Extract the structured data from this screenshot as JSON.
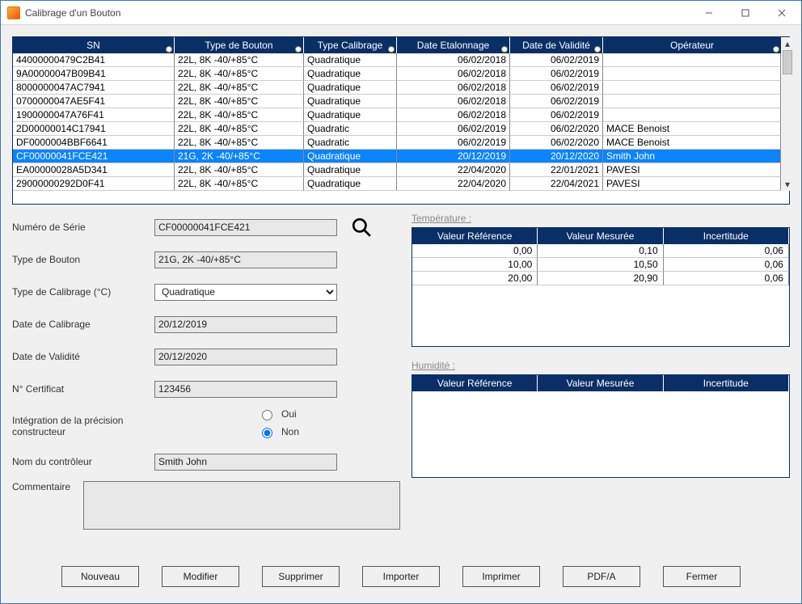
{
  "window": {
    "title": "Calibrage d'un Bouton"
  },
  "grid": {
    "columns": [
      "SN",
      "Type de Bouton",
      "Type Calibrage",
      "Date Etalonnage",
      "Date de Validité",
      "Opérateur"
    ],
    "rows": [
      {
        "sn": "44000000479C2B41",
        "type": "22L, 8K -40/+85°C",
        "cal": "Quadratique",
        "eta": "06/02/2018",
        "val": "06/02/2019",
        "op": ""
      },
      {
        "sn": "9A00000047B09B41",
        "type": "22L, 8K -40/+85°C",
        "cal": "Quadratique",
        "eta": "06/02/2018",
        "val": "06/02/2019",
        "op": ""
      },
      {
        "sn": "8000000047AC7941",
        "type": "22L, 8K -40/+85°C",
        "cal": "Quadratique",
        "eta": "06/02/2018",
        "val": "06/02/2019",
        "op": ""
      },
      {
        "sn": "0700000047AE5F41",
        "type": "22L, 8K -40/+85°C",
        "cal": "Quadratique",
        "eta": "06/02/2018",
        "val": "06/02/2019",
        "op": ""
      },
      {
        "sn": "1900000047A76F41",
        "type": "22L, 8K -40/+85°C",
        "cal": "Quadratique",
        "eta": "06/02/2018",
        "val": "06/02/2019",
        "op": ""
      },
      {
        "sn": "2D00000014C17941",
        "type": "22L, 8K -40/+85°C",
        "cal": "Quadratic",
        "eta": "06/02/2019",
        "val": "06/02/2020",
        "op": "MACE Benoist"
      },
      {
        "sn": "DF0000004BBF6641",
        "type": "22L, 8K -40/+85°C",
        "cal": "Quadratic",
        "eta": "06/02/2019",
        "val": "06/02/2020",
        "op": "MACE Benoist"
      },
      {
        "sn": "CF00000041FCE421",
        "type": "21G, 2K -40/+85°C",
        "cal": "Quadratique",
        "eta": "20/12/2019",
        "val": "20/12/2020",
        "op": "Smith John",
        "selected": true
      },
      {
        "sn": "EA00000028A5D341",
        "type": "22L, 8K -40/+85°C",
        "cal": "Quadratique",
        "eta": "22/04/2020",
        "val": "22/01/2021",
        "op": "PAVESI"
      },
      {
        "sn": "29000000292D0F41",
        "type": "22L, 8K -40/+85°C",
        "cal": "Quadratique",
        "eta": "22/04/2020",
        "val": "22/04/2021",
        "op": "PAVESI"
      }
    ]
  },
  "form": {
    "sn_label": "Numéro de Série",
    "sn": "CF00000041FCE421",
    "type_label": "Type de Bouton",
    "type": "21G, 2K -40/+85°C",
    "caltype_label": "Type de Calibrage (°C)",
    "caltype": "Quadratique",
    "date_label": "Date de Calibrage",
    "date": "20/12/2019",
    "valid_label": "Date de Validité",
    "valid": "20/12/2020",
    "cert_label": "N° Certificat",
    "cert": "123456",
    "precision_label": "Intégration de la précision constructeur",
    "precision_yes": "Oui",
    "precision_no": "Non",
    "precision_value": "Non",
    "controller_label": "Nom du contrôleur",
    "controller": "Smith John",
    "comment_label": "Commentaire"
  },
  "temp": {
    "title": "Température :",
    "columns": [
      "Valeur Référence",
      "Valeur Mesurée",
      "Incertitude"
    ],
    "rows": [
      {
        "ref": "0,00",
        "mes": "0,10",
        "inc": "0,06"
      },
      {
        "ref": "10,00",
        "mes": "10,50",
        "inc": "0,06"
      },
      {
        "ref": "20,00",
        "mes": "20,90",
        "inc": "0,06"
      }
    ]
  },
  "hum": {
    "title": "Humidité :",
    "columns": [
      "Valeur Référence",
      "Valeur Mesurée",
      "Incertitude"
    ]
  },
  "buttons": {
    "nouveau": "Nouveau",
    "modifier": "Modifier",
    "supprimer": "Supprimer",
    "importer": "Importer",
    "imprimer": "Imprimer",
    "pdfa": "PDF/A",
    "fermer": "Fermer"
  }
}
